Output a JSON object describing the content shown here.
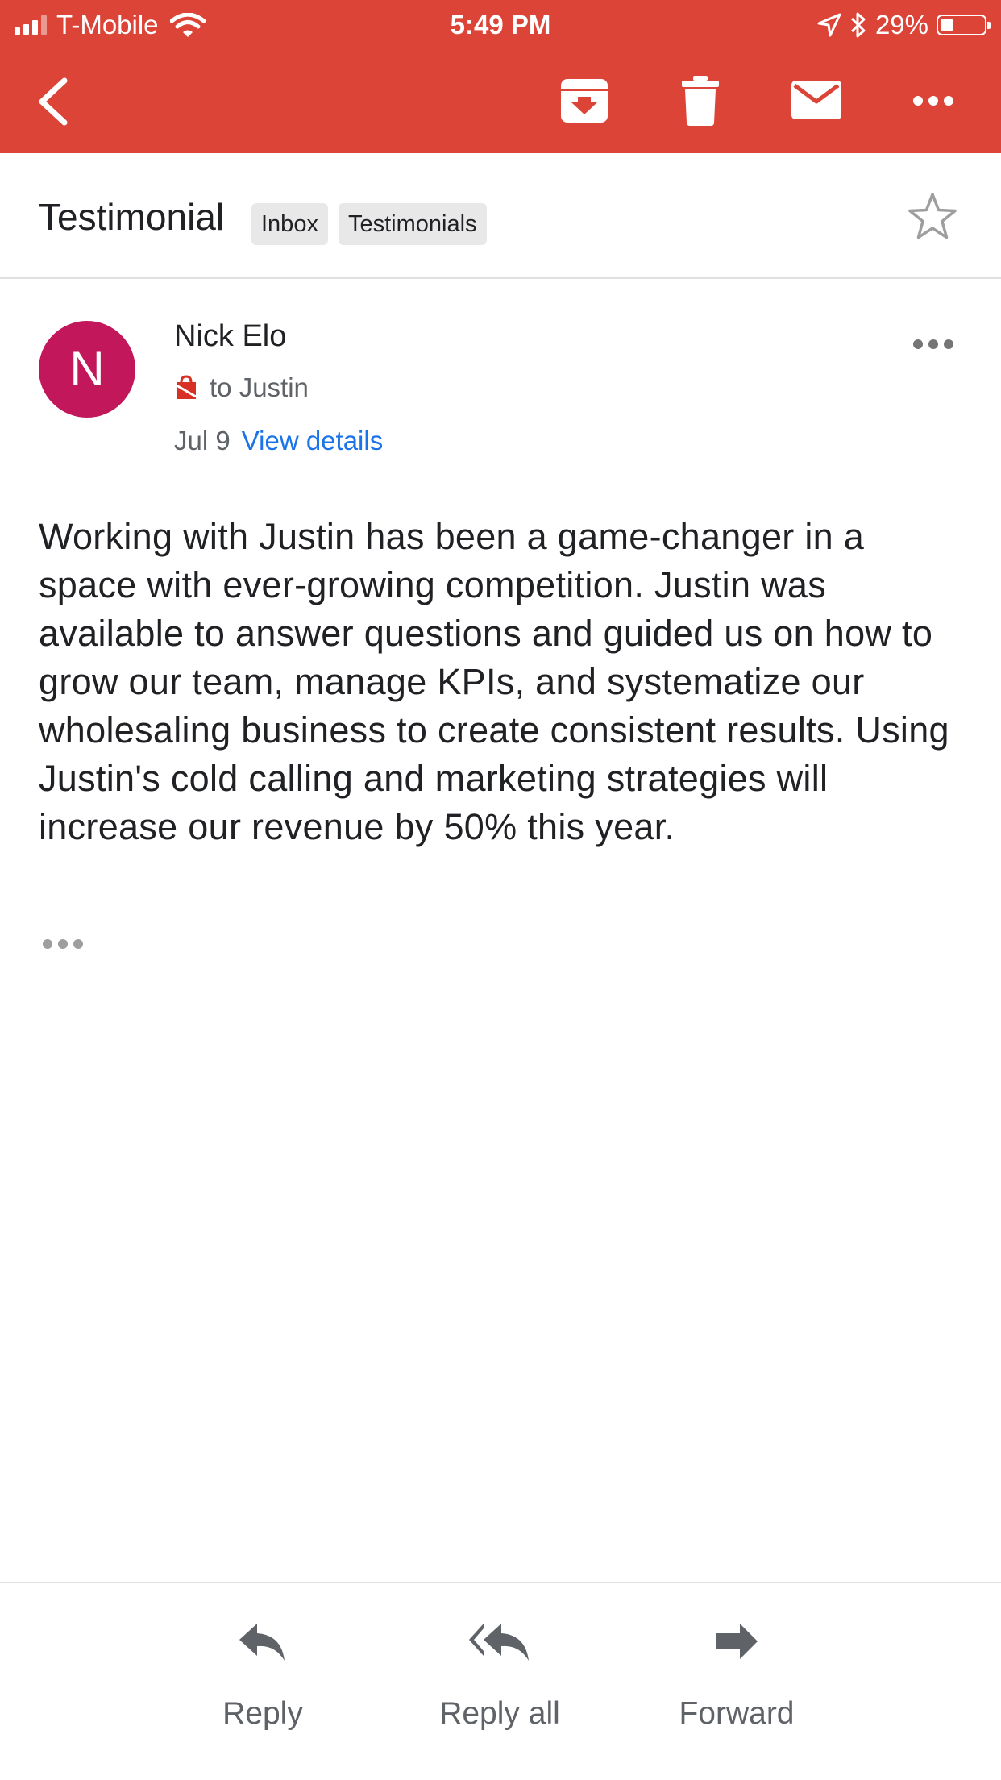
{
  "status_bar": {
    "carrier": "T-Mobile",
    "time": "5:49 PM",
    "battery": "29%",
    "battery_level": 0.29
  },
  "toolbar": {
    "icons": [
      "back-arrow-icon",
      "archive-icon",
      "trash-icon",
      "mail-icon",
      "more-horizontal-icon"
    ],
    "accent_color": "#db4437"
  },
  "thread": {
    "subject": "Testimonial",
    "labels": [
      "Inbox",
      "Testimonials"
    ]
  },
  "message": {
    "avatar_initial": "N",
    "avatar_color": "#c2185b",
    "sender": "Nick Elo",
    "recipient": "to Justin",
    "date": "Jul 9",
    "details_link": "View details",
    "body": "Working with Justin has been a game-changer in a space with ever-growing competition. Justin was available to answer questions and guided us on how to grow our team, manage KPIs, and systematize our wholesaling business to create consistent results. Using Justin's cold calling and marketing strategies will increase our revenue by 50% this year."
  },
  "actions": {
    "reply": "Reply",
    "reply_all": "Reply all",
    "forward": "Forward"
  }
}
